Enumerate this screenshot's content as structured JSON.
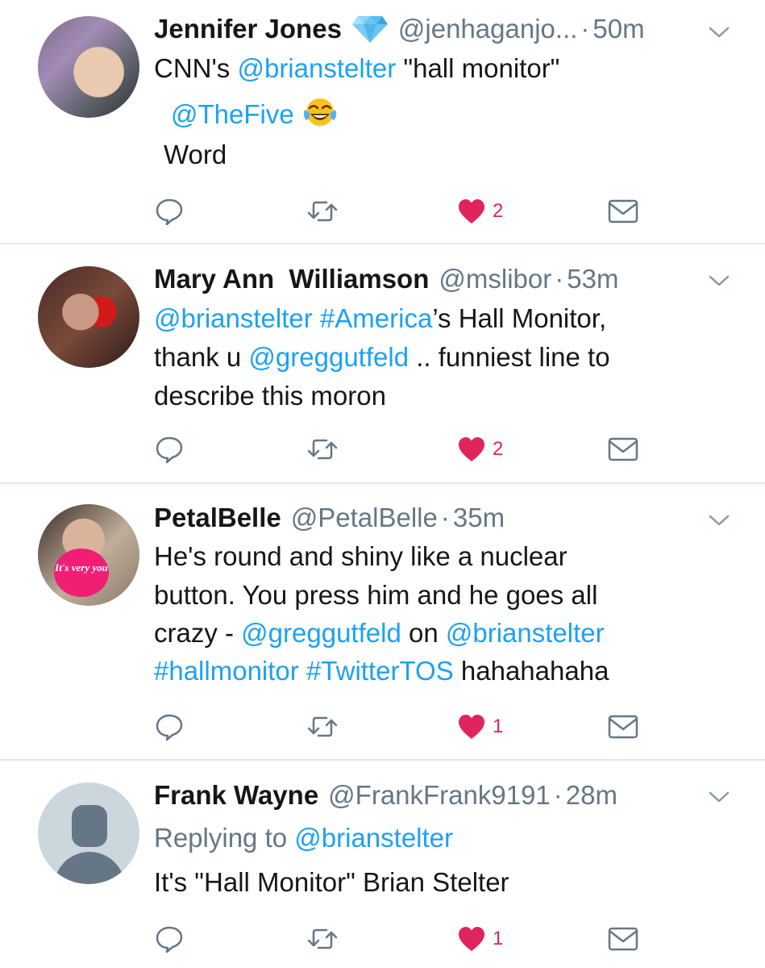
{
  "tweets": [
    {
      "name": "Jennifer Jones",
      "handle": "@jenhaganjo...",
      "time": "50m",
      "lines": [
        [
          {
            "t": "CNN's ",
            "link": false
          },
          {
            "t": "@brianstelter",
            "link": true
          },
          {
            "t": " \"hall monitor\"",
            "link": false
          }
        ],
        [
          {
            "t": "@TheFive",
            "link": true
          }
        ],
        [
          {
            "t": "Word",
            "link": false
          }
        ]
      ],
      "likes": "2"
    },
    {
      "name": "Mary Ann  Williamson",
      "handle": "@mslibor",
      "time": "53m",
      "lines": [
        [
          {
            "t": "@brianstelter",
            "link": true
          },
          {
            "t": " ",
            "link": false
          },
          {
            "t": "#America",
            "link": true
          },
          {
            "t": "’s Hall Monitor,",
            "link": false
          }
        ],
        [
          {
            "t": "thank u ",
            "link": false
          },
          {
            "t": "@greggutfeld",
            "link": true
          },
          {
            "t": " .. funniest line to",
            "link": false
          }
        ],
        [
          {
            "t": "describe this moron",
            "link": false
          }
        ]
      ],
      "likes": "2"
    },
    {
      "name": "PetalBelle",
      "handle": "@PetalBelle",
      "time": "35m",
      "avatar_badge": "It's very you",
      "lines": [
        [
          {
            "t": "He's round and shiny like a nuclear",
            "link": false
          }
        ],
        [
          {
            "t": "button. You press him and he goes all",
            "link": false
          }
        ],
        [
          {
            "t": "crazy - ",
            "link": false
          },
          {
            "t": "@greggutfeld",
            "link": true
          },
          {
            "t": " on ",
            "link": false
          },
          {
            "t": "@brianstelter",
            "link": true
          }
        ],
        [
          {
            "t": "#hallmonitor",
            "link": true
          },
          {
            "t": " ",
            "link": false
          },
          {
            "t": "#TwitterTOS",
            "link": true
          },
          {
            "t": " hahahahaha",
            "link": false
          }
        ]
      ],
      "likes": "1"
    },
    {
      "name": "Frank Wayne",
      "handle": "@FrankFrank9191",
      "time": "28m",
      "reply_prefix": "Replying to ",
      "reply_to": "@brianstelter",
      "lines": [
        [
          {
            "t": "It's \"Hall Monitor\" Brian Stelter",
            "link": false
          }
        ]
      ],
      "likes": "1"
    }
  ],
  "separator_dot": "·",
  "icons": {
    "reply": "reply-bubble-icon",
    "retweet": "retweet-icon",
    "like": "heart-icon",
    "dm": "envelope-icon",
    "menu": "chevron-down-icon",
    "verified_emoji": "diamond-emoji-icon",
    "laugh_emoji": "tears-of-joy-emoji-icon"
  },
  "colors": {
    "link": "#1da1f2",
    "secondary": "#657786",
    "like": "#e0245e",
    "divider": "#e1e8ed"
  }
}
